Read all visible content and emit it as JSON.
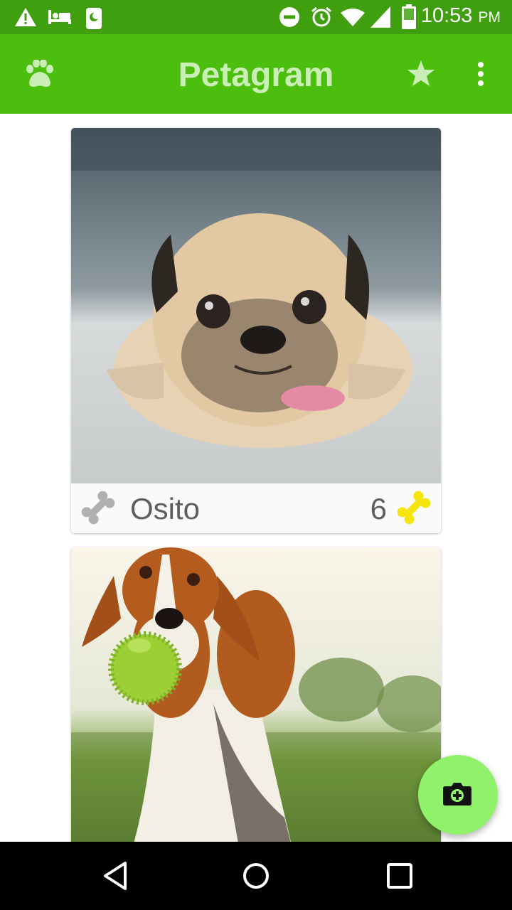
{
  "status_bar": {
    "time": "10:53",
    "ampm": "PM",
    "icons": [
      "warning-icon",
      "bed-icon",
      "phone-moon-icon",
      "do-not-disturb-icon",
      "alarm-icon",
      "wifi-icon",
      "signal-icon",
      "battery-icon"
    ]
  },
  "app_bar": {
    "title": "Petagram",
    "left_icon": "paw-icon",
    "right_icons": [
      "star-icon",
      "overflow-menu-icon"
    ]
  },
  "pets": [
    {
      "name": "Osito",
      "likes": "6"
    },
    {
      "name": "",
      "likes": ""
    }
  ],
  "fab": {
    "icon": "add-photo-camera-icon"
  },
  "colors": {
    "status_bar": "#3f9f0f",
    "app_bar": "#4cbe0d",
    "title": "#c9efb7",
    "fab": "#8ff26a",
    "liked_bone": "#f5e50a",
    "unliked_bone": "#b0b0b0"
  },
  "nav_bar": {
    "icons": [
      "back-icon",
      "home-icon",
      "recents-icon"
    ]
  }
}
